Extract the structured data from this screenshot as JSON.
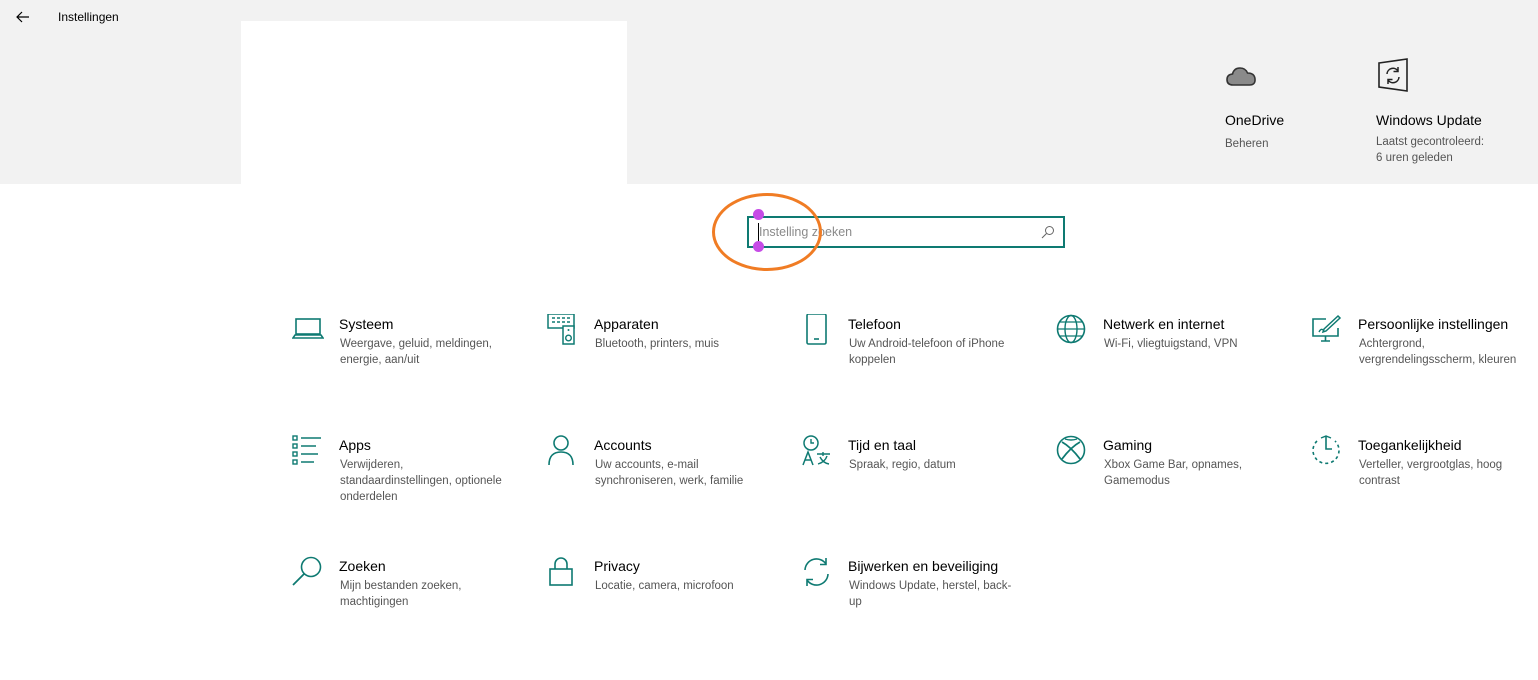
{
  "window": {
    "title": "Instellingen"
  },
  "quick_actions": [
    {
      "title": "OneDrive",
      "subtitle": "Beheren",
      "icon": "cloud-icon"
    },
    {
      "title": "Windows Update",
      "subtitle_line1": "Laatst gecontroleerd:",
      "subtitle_line2": "6 uren geleden",
      "icon": "windows-update-icon"
    }
  ],
  "search": {
    "placeholder": "Instelling zoeken",
    "value": ""
  },
  "colors": {
    "accent": "#0e7a72",
    "header_bg": "#f2f2f2",
    "annotation": "#f07c24",
    "handle": "#c64be6"
  },
  "categories": [
    {
      "title": "Systeem",
      "description": "Weergave, geluid, meldingen, energie, aan/uit",
      "icon": "laptop-icon"
    },
    {
      "title": "Apparaten",
      "description": "Bluetooth, printers, muis",
      "icon": "devices-icon"
    },
    {
      "title": "Telefoon",
      "description": "Uw Android-telefoon of iPhone koppelen",
      "icon": "phone-icon"
    },
    {
      "title": "Netwerk en internet",
      "description": "Wi-Fi, vliegtuigstand, VPN",
      "icon": "globe-icon"
    },
    {
      "title": "Persoonlijke instellingen",
      "description": "Achtergrond, vergrendelingsscherm, kleuren",
      "icon": "personalization-icon"
    },
    {
      "title": "Apps",
      "description": "Verwijderen, standaardinstellingen, optionele onderdelen",
      "icon": "apps-list-icon"
    },
    {
      "title": "Accounts",
      "description": "Uw accounts, e-mail synchroniseren, werk, familie",
      "icon": "person-icon"
    },
    {
      "title": "Tijd en taal",
      "description": "Spraak, regio, datum",
      "icon": "time-language-icon"
    },
    {
      "title": "Gaming",
      "description": "Xbox Game Bar, opnames, Gamemodus",
      "icon": "xbox-icon"
    },
    {
      "title": "Toegankelijkheid",
      "description": "Verteller, vergrootglas, hoog contrast",
      "icon": "accessibility-icon"
    },
    {
      "title": "Zoeken",
      "description": "Mijn bestanden zoeken, machtigingen",
      "icon": "search-icon"
    },
    {
      "title": "Privacy",
      "description": "Locatie, camera, microfoon",
      "icon": "lock-icon"
    },
    {
      "title": "Bijwerken en beveiliging",
      "description": "Windows Update, herstel, back-up",
      "icon": "update-sync-icon"
    }
  ]
}
